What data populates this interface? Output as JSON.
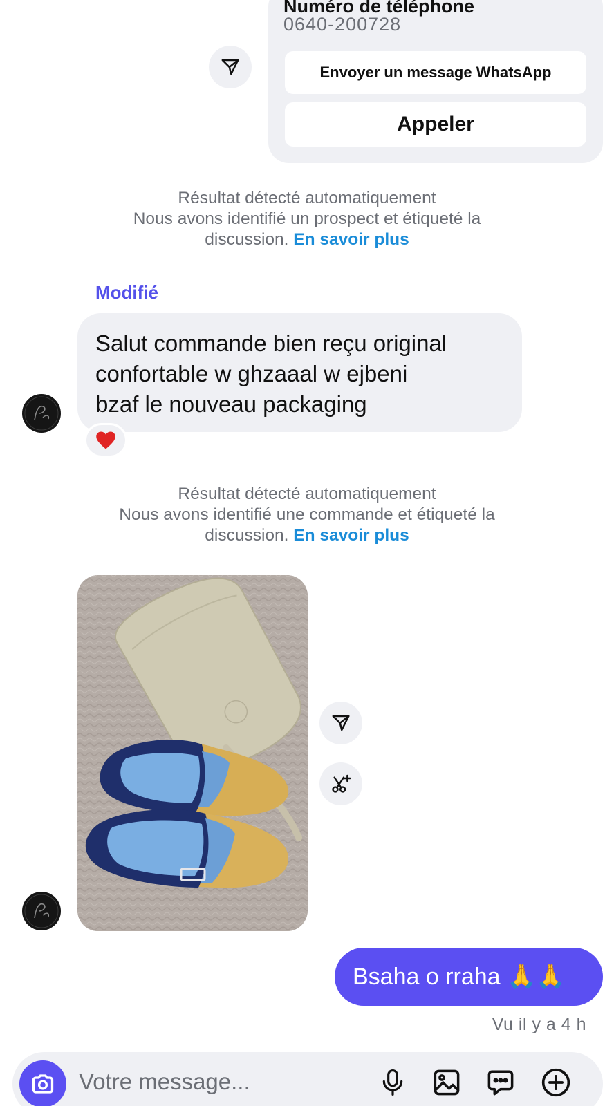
{
  "contact_card": {
    "label": "Numéro de téléphone",
    "phone": "0640-200728",
    "whatsapp_button": "Envoyer un message WhatsApp",
    "call_button": "Appeler"
  },
  "system_note_1": {
    "line1": "Résultat détecté automatiquement",
    "line2": "Nous avons identifié un prospect et étiqueté la",
    "line3": "discussion.",
    "link": "En savoir plus"
  },
  "incoming_message": {
    "edited_label": "Modifié",
    "lines": [
      "Salut commande bien reçu original",
      "confortable w ghzaaal w ejbeni",
      "bzaf le nouveau packaging"
    ],
    "reaction": "❤️"
  },
  "system_note_2": {
    "line1": "Résultat détecté automatiquement",
    "line2": "Nous avons identifié une commande et étiqueté la",
    "line3": "discussion.",
    "link": "En savoir plus"
  },
  "outgoing_message": {
    "text": "Bsaha o rraha 🙏🙏"
  },
  "seen_status": "Vu il y a 4 h",
  "composer": {
    "placeholder": "Votre message..."
  },
  "icons": {
    "share": "send-paper-plane-icon",
    "ai_edit": "scissors-sparkle-icon",
    "camera": "camera-icon",
    "mic": "microphone-icon",
    "gallery": "image-gallery-icon",
    "sticker": "chat-bubble-dots-icon",
    "more": "plus-circle-icon"
  },
  "colors": {
    "accent": "#5b4ff2",
    "bubble_in": "#eff0f4",
    "link": "#1a8cd8",
    "edited": "#5451ea",
    "muted_text": "#6b6e75"
  }
}
